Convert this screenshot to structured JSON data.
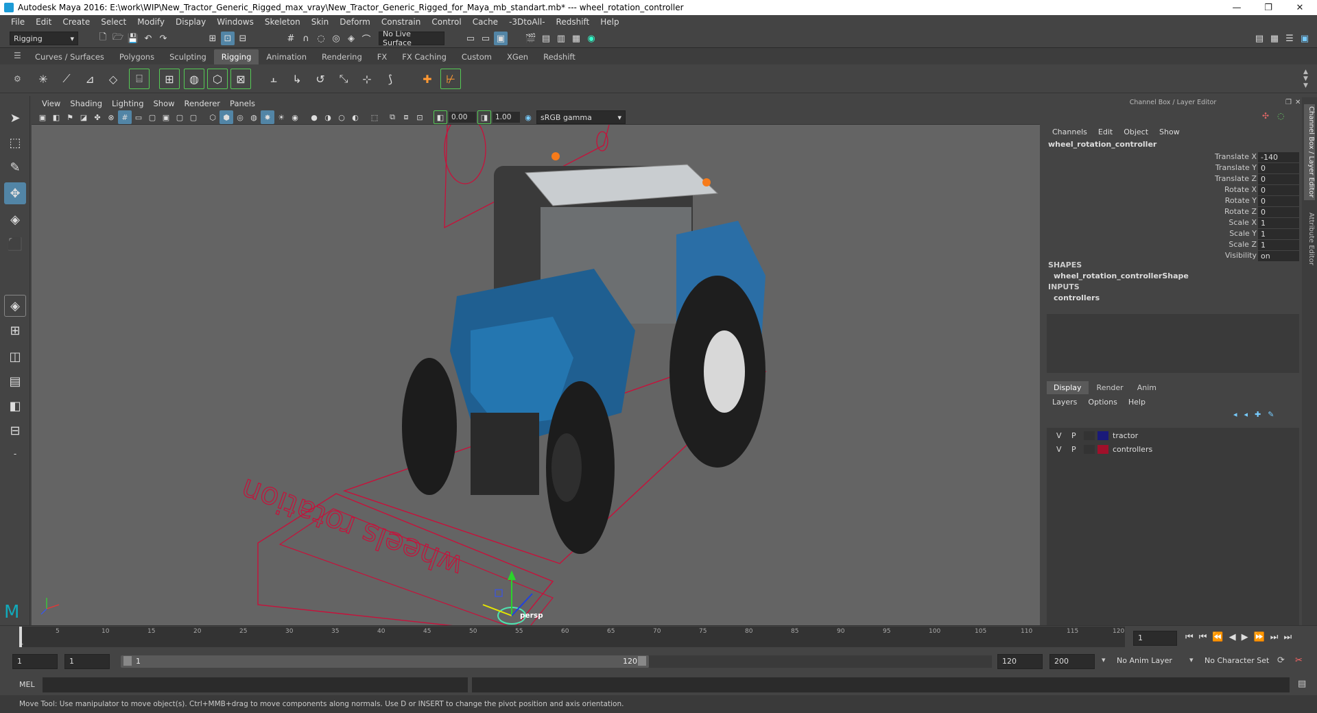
{
  "window": {
    "title": "Autodesk Maya 2016: E:\\work\\WIP\\New_Tractor_Generic_Rigged_max_vray\\New_Tractor_Generic_Rigged_for_Maya_mb_standart.mb*   ---   wheel_rotation_controller",
    "minimize": "—",
    "maximize": "❐",
    "close": "✕"
  },
  "menubar": [
    "File",
    "Edit",
    "Create",
    "Select",
    "Modify",
    "Display",
    "Windows",
    "Skeleton",
    "Skin",
    "Deform",
    "Constrain",
    "Control",
    "Cache",
    "-3DtoAll-",
    "Redshift",
    "Help"
  ],
  "statusline": {
    "menuset": "Rigging",
    "live_surface": "No Live Surface"
  },
  "shelf_tabs": [
    "Curves / Surfaces",
    "Polygons",
    "Sculpting",
    "Rigging",
    "Animation",
    "Rendering",
    "FX",
    "FX Caching",
    "Custom",
    "XGen",
    "Redshift"
  ],
  "shelf_active": "Rigging",
  "viewport": {
    "menu": [
      "View",
      "Shading",
      "Lighting",
      "Show",
      "Renderer",
      "Panels"
    ],
    "exposure": "0.00",
    "gamma": "1.00",
    "colorspace": "sRGB gamma",
    "camera_label": "persp",
    "ground_text": "wheels rotation"
  },
  "channel_box": {
    "header": "Channel Box / Layer Editor",
    "menu": [
      "Channels",
      "Edit",
      "Object",
      "Show"
    ],
    "object_name": "wheel_rotation_controller",
    "channels": [
      {
        "label": "Translate X",
        "value": "-140"
      },
      {
        "label": "Translate Y",
        "value": "0"
      },
      {
        "label": "Translate Z",
        "value": "0"
      },
      {
        "label": "Rotate X",
        "value": "0"
      },
      {
        "label": "Rotate Y",
        "value": "0"
      },
      {
        "label": "Rotate Z",
        "value": "0"
      },
      {
        "label": "Scale X",
        "value": "1"
      },
      {
        "label": "Scale Y",
        "value": "1"
      },
      {
        "label": "Scale Z",
        "value": "1"
      },
      {
        "label": "Visibility",
        "value": "on"
      }
    ],
    "shapes_header": "SHAPES",
    "shape_name": "wheel_rotation_controllerShape",
    "inputs_header": "INPUTS",
    "input_name": "controllers"
  },
  "layer_editor": {
    "tabs": [
      "Display",
      "Render",
      "Anim"
    ],
    "active_tab": "Display",
    "menu": [
      "Layers",
      "Options",
      "Help"
    ],
    "layers": [
      {
        "v": "V",
        "p": "P",
        "color": "#1a1a7a",
        "name": "tractor"
      },
      {
        "v": "V",
        "p": "P",
        "color": "#a0102a",
        "name": "controllers"
      }
    ]
  },
  "side_tabs": {
    "channel": "Channel Box / Layer Editor",
    "attribute": "Attribute Editor"
  },
  "timeline": {
    "ticks": [
      "1",
      "5",
      "10",
      "15",
      "20",
      "25",
      "30",
      "35",
      "40",
      "45",
      "50",
      "55",
      "60",
      "65",
      "70",
      "75",
      "80",
      "85",
      "90",
      "95",
      "100",
      "105",
      "110",
      "115",
      "120"
    ],
    "current_frame": "1",
    "playback": [
      "⏮",
      "⏮",
      "⏪",
      "◀",
      "▶",
      "⏩",
      "⏭",
      "⏭"
    ]
  },
  "range": {
    "start": "1",
    "start2": "1",
    "slider_start": "1",
    "slider_end": "120",
    "end": "120",
    "max_end": "200",
    "anim_layer": "No Anim Layer",
    "char_set": "No Character Set"
  },
  "command_line": {
    "label": "MEL"
  },
  "help_line": "Move Tool: Use manipulator to move object(s). Ctrl+MMB+drag to move components along normals. Use D or INSERT to change the pivot position and axis orientation."
}
